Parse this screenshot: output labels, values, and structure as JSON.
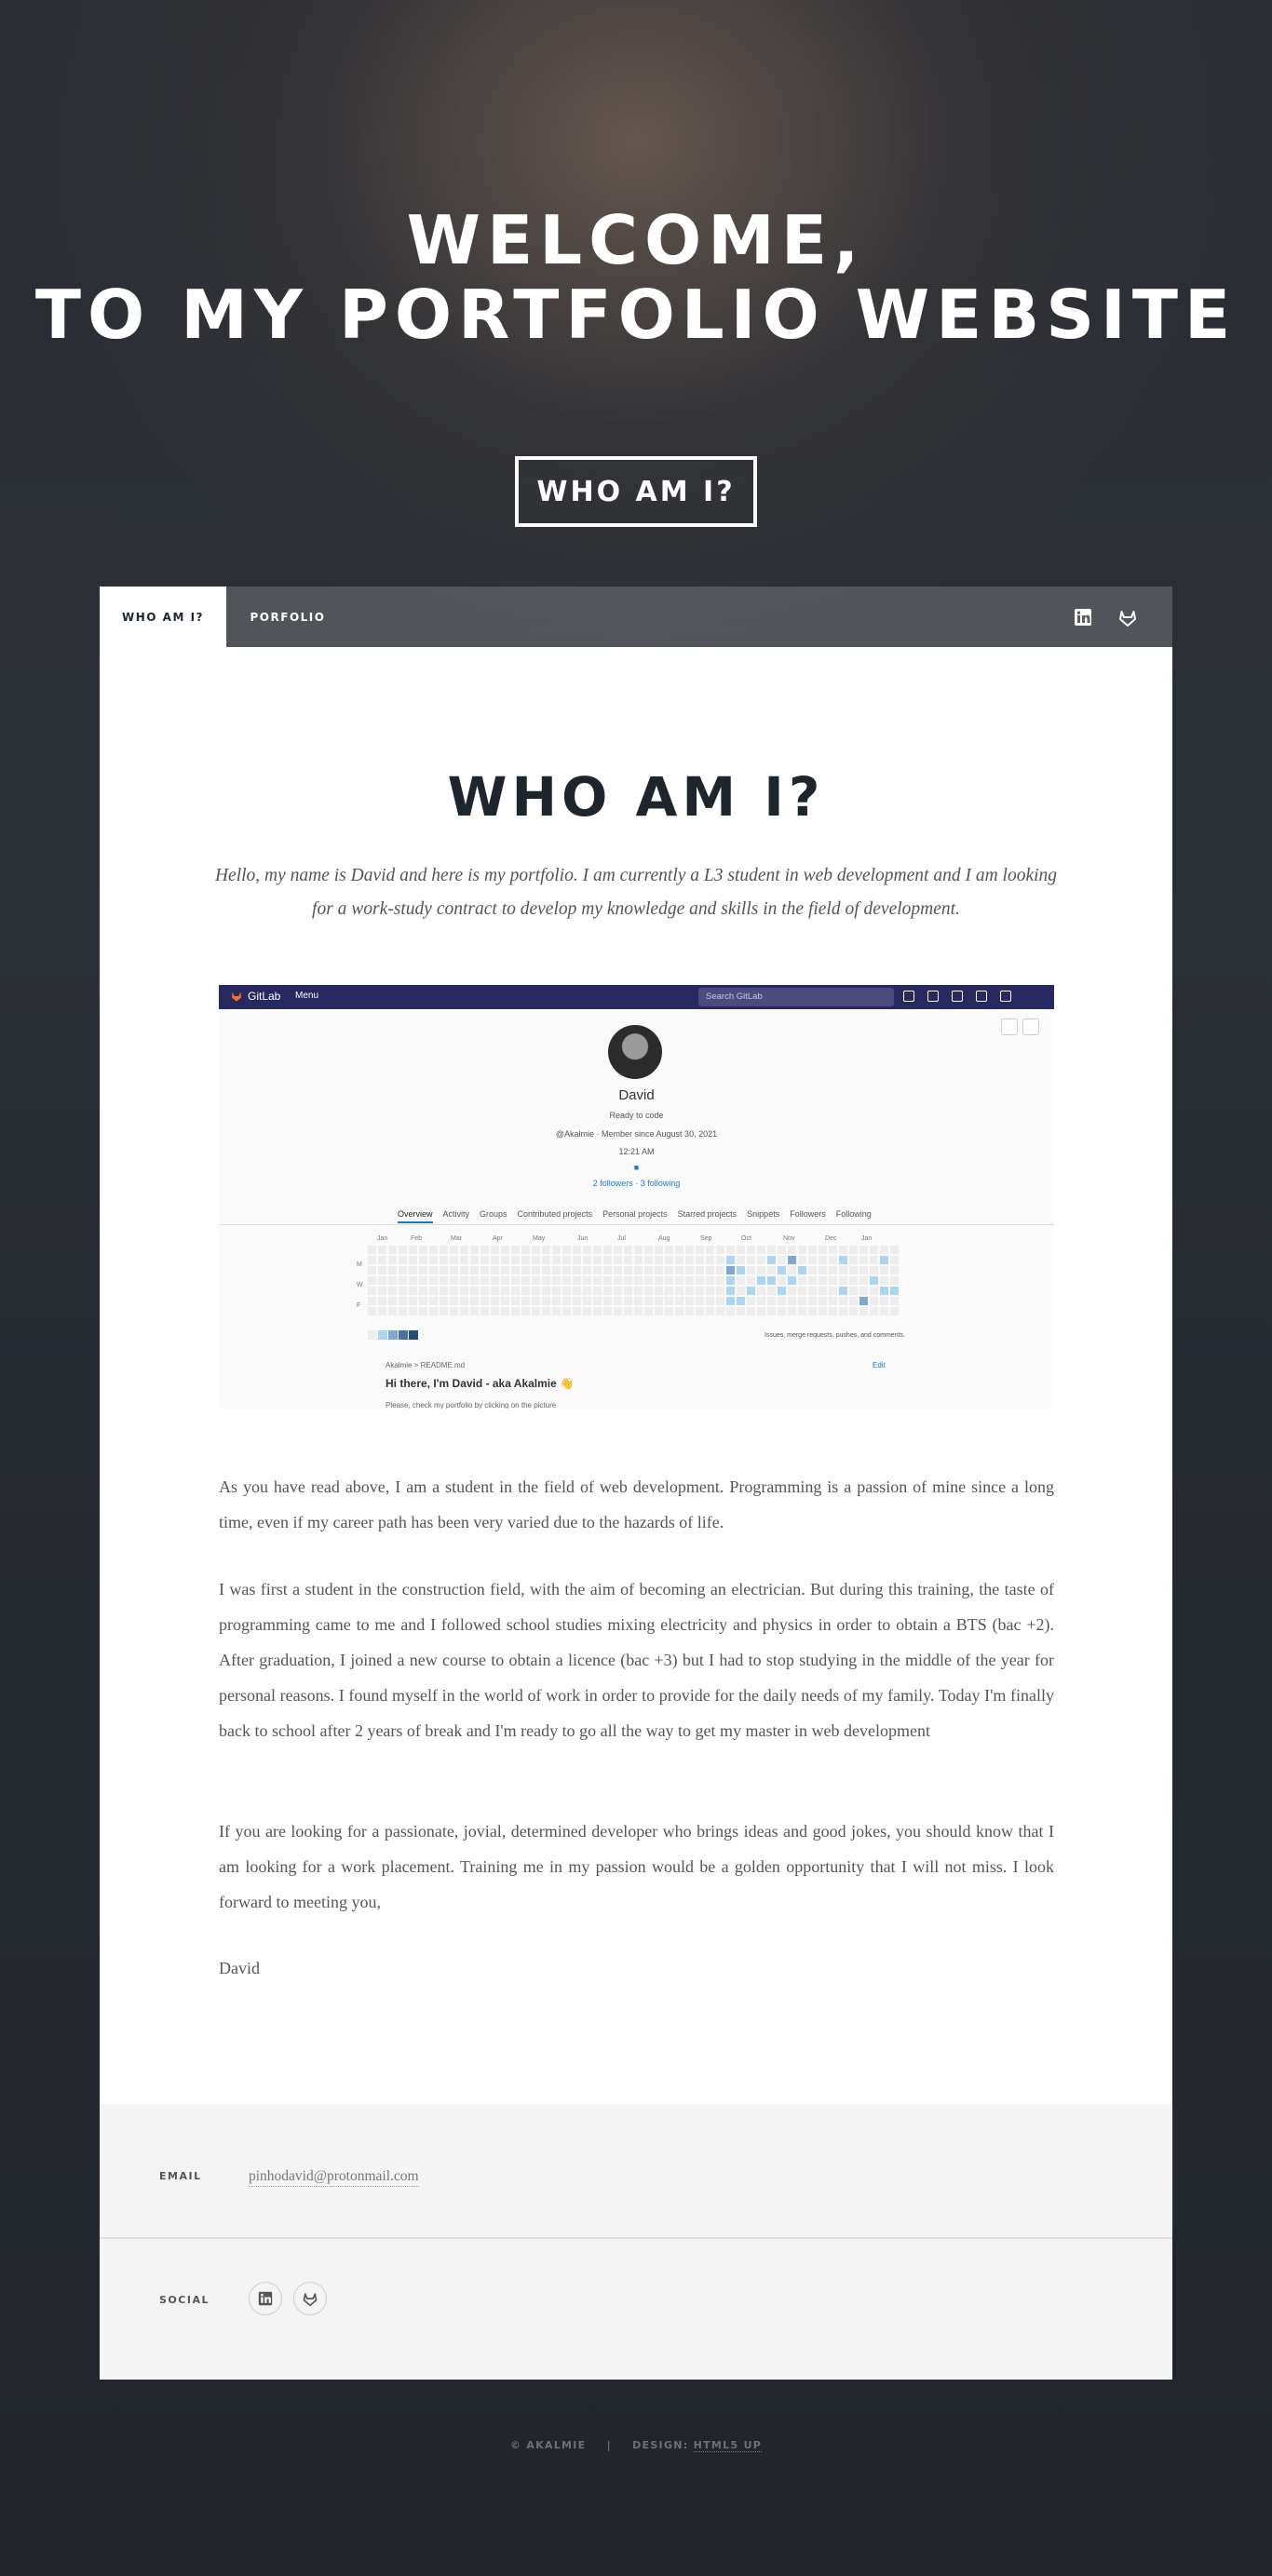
{
  "intro": {
    "title_line1": "WELCOME,",
    "title_line2": "TO MY PORTFOLIO WEBSITE",
    "button": "WHO AM I?"
  },
  "nav": {
    "tabs": [
      {
        "label": "WHO AM I?",
        "active": true
      },
      {
        "label": "PORFOLIO",
        "active": false
      }
    ],
    "icons": [
      "linkedin-icon",
      "gitlab-icon"
    ]
  },
  "main": {
    "heading": "WHO AM I?",
    "lead": "Hello, my name is David and here is my portfolio. I am currently a L3 student in web development and I am looking for a work-study contract to develop my knowledge and skills in the field of development.",
    "paragraphs": [
      "As you have read above, I am a student in the field of web development. Programming is a passion of mine since a long time, even if my career path has been very varied due to the hazards of life.",
      "I was first a student in the construction field, with the aim of becoming an electrician. But during this training, the taste of programming came to me and I followed school studies mixing electricity and physics in order to obtain a BTS (bac +2). After graduation, I joined a new course to obtain a licence (bac +3) but I had to stop studying in the middle of the year for personal reasons. I found myself in the world of work in order to provide for the daily needs of my family. Today I'm finally back to school after 2 years of break and I'm ready to go all the way to get my master in web development",
      "If you are looking for a passionate, jovial, determined developer who brings ideas and good jokes, you should know that I am looking for a work placement. Training me in my passion would be a golden opportunity that I will not miss. I look forward to meeting you,",
      "David"
    ]
  },
  "screenshot": {
    "brand": "GitLab",
    "menu": "Menu",
    "search_placeholder": "Search GitLab",
    "name": "David",
    "status": "Ready to code",
    "meta": "@Akalmie · Member since August 30, 2021",
    "time": "12:21 AM",
    "follow": "2 followers · 3 following",
    "tabs": [
      "Overview",
      "Activity",
      "Groups",
      "Contributed projects",
      "Personal projects",
      "Starred projects",
      "Snippets",
      "Followers",
      "Following"
    ],
    "months": [
      "Jan",
      "Feb",
      "Mar",
      "Apr",
      "May",
      "Jun",
      "Jul",
      "Aug",
      "Sep",
      "Oct",
      "Nov",
      "Dec",
      "Jan"
    ],
    "days": [
      "M",
      "W",
      "F"
    ],
    "legend_text": "Issues, merge requests, pushes, and comments.",
    "readme_crumb": "Akalmie  >  README.md",
    "edit": "Edit",
    "readme_title": "Hi there, I'm David - aka Akalmie 👋",
    "readme_line": "Please, check my portfolio by clicking on the picture"
  },
  "contact": {
    "email_label": "EMAIL",
    "email": "pinhodavid@protonmail.com",
    "social_label": "SOCIAL",
    "social_icons": [
      "linkedin-icon",
      "gitlab-icon"
    ]
  },
  "footer": {
    "copyright": "© AKALMIE",
    "design_prefix": "DESIGN: ",
    "design_link": "HTML5 UP"
  },
  "colors": {
    "accent": "#1e252d",
    "gitlab_nav": "#292961",
    "contrib_light": "#acd5f2",
    "contrib_mid": "#7fa8d1",
    "contrib_dark": "#49729b"
  }
}
